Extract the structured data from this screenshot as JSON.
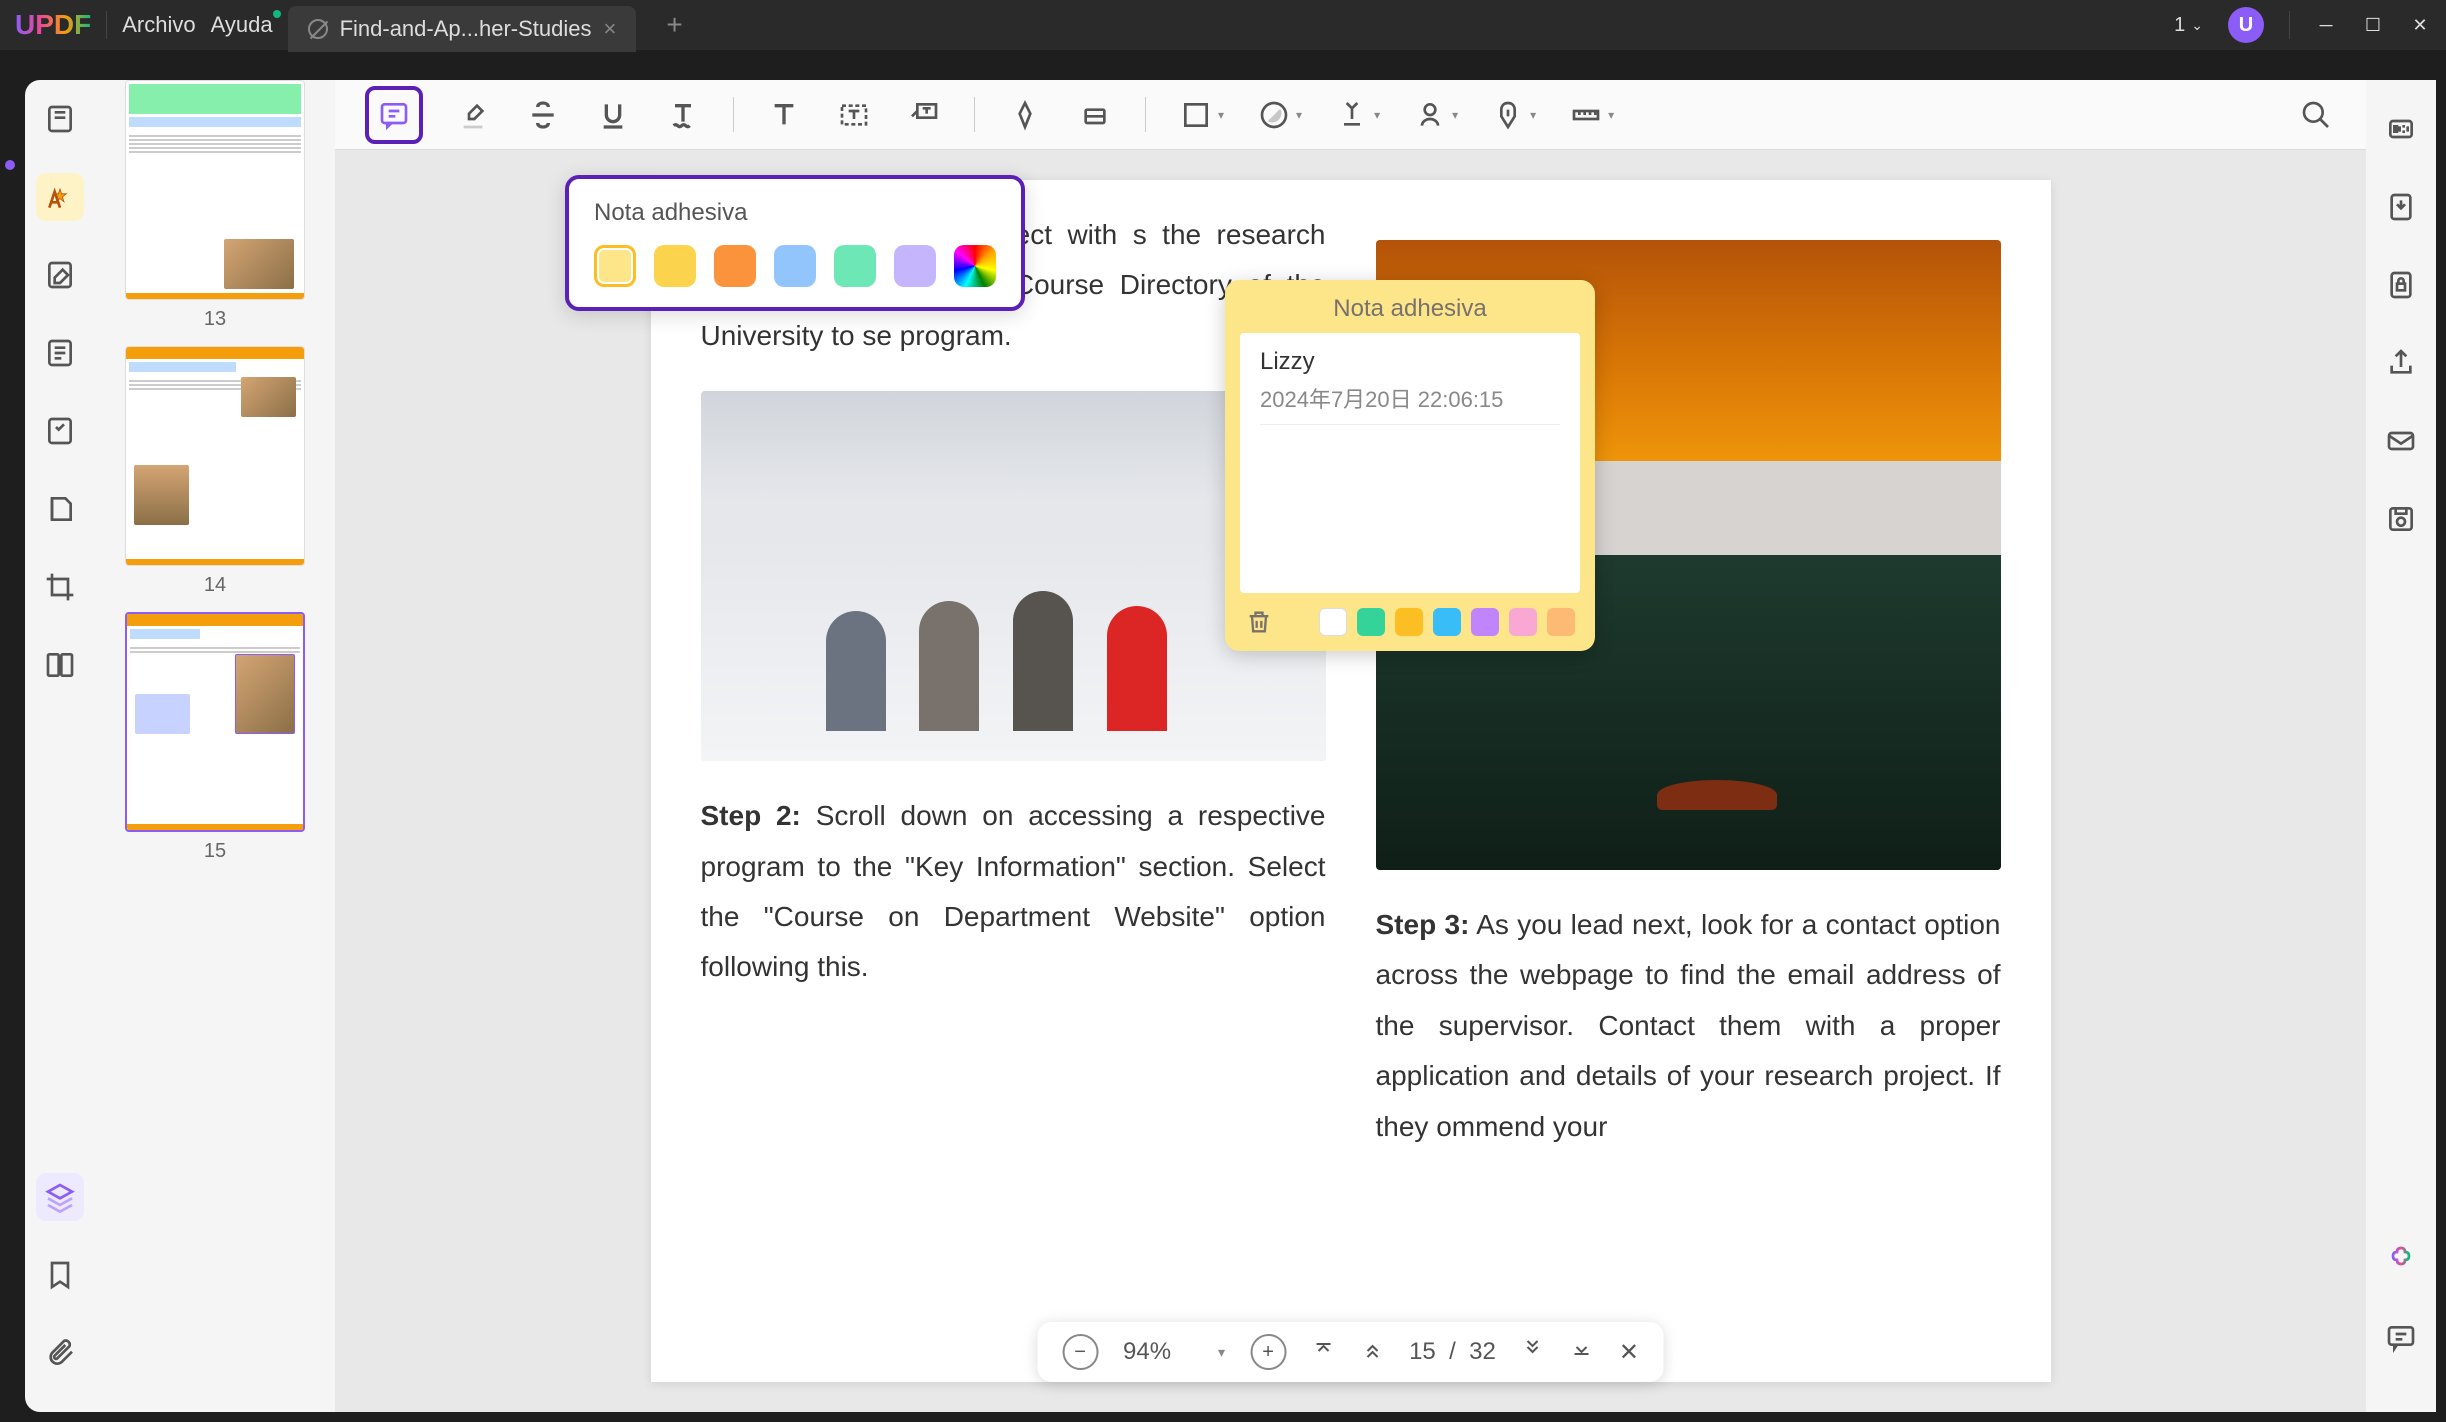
{
  "titlebar": {
    "logo": "UPDF",
    "menu_file": "Archivo",
    "menu_help": "Ayuda",
    "tab_title": "Find-and-Ap...her-Studies",
    "window_count": "1",
    "avatar_letter": "U"
  },
  "color_popup": {
    "title": "Nota adhesiva",
    "colors": [
      "#fde68a",
      "#fcd34d",
      "#fb923c",
      "#93c5fd",
      "#6ee7b7",
      "#c4b5fd"
    ]
  },
  "sticky_note": {
    "title": "Nota adhesiva",
    "author": "Lizzy",
    "date": "2024年7月20日 22:06:15",
    "colors": [
      "#ffffff",
      "#34d399",
      "#fbbf24",
      "#38bdf8",
      "#c084fc",
      "#f9a8d4",
      "#fdba74"
    ]
  },
  "document": {
    "para1": "he supervisor and connect with s the research project. Go across the Course Directory of the University to se program.",
    "step2_label": "Step 2:",
    "step2_text": " Scroll down on accessing a respective program to the \"Key Information\" section. Select the \"Course on Department Website\" option following this.",
    "step3_label": "Step 3:",
    "step3_text": " As you lead next, look for a contact option across the webpage to find the email address of the supervisor. Contact them with a proper application and details of your research project. If they ommend your"
  },
  "thumbs": {
    "p13": "13",
    "p14": "14",
    "p15": "15"
  },
  "zoom": {
    "value": "94%",
    "page_current": "15",
    "page_sep": "/",
    "page_total": "32"
  }
}
